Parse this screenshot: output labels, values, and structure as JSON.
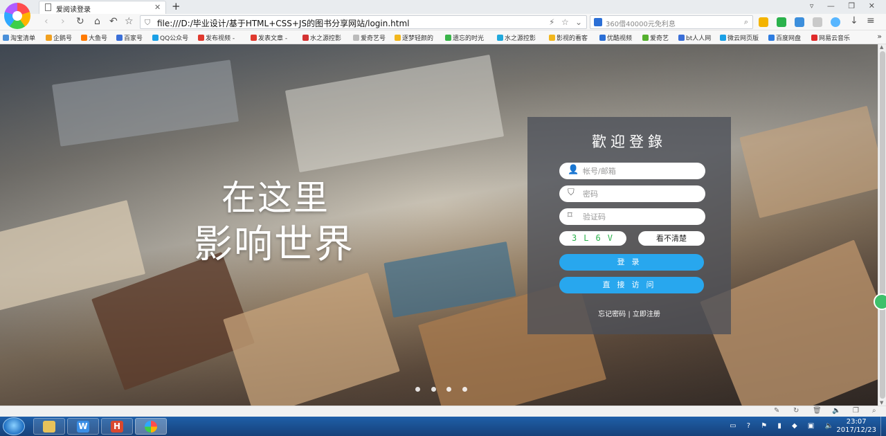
{
  "browser": {
    "tab_title": "爱阅读登录",
    "url": "file:///D:/毕业设计/基于HTML+CSS+JS的图书分享网站/login.html",
    "search_placeholder": "360借40000元免利息"
  },
  "bookmarks": [
    "淘宝清单",
    "企鹅号",
    "大鱼号",
    "百家号",
    "QQ公众号",
    "发布视频 -",
    "发表文章 -",
    "水之源控影",
    "爱奇艺号",
    "逐梦轻颜的",
    "遗忘的时光",
    "水之源控影",
    "影视的看客",
    "优酷视频",
    "爱奇艺",
    "bt人人网",
    "微云网页版",
    "百度网盘",
    "网易云音乐"
  ],
  "page": {
    "slogan_line1": "在这里",
    "slogan_line2": "影响世界",
    "welcome": "歡迎登錄",
    "username_placeholder": "帐号/邮箱",
    "password_placeholder": "密码",
    "captcha_placeholder": "验证码",
    "captcha_code": "3L6V",
    "refresh_captcha": "看不清楚",
    "login_button": "登录",
    "guest_button": "直接访问",
    "forgot_password": "忘记密码",
    "separator": "|",
    "register": "立即注册",
    "carousel_slides": 4
  },
  "taskbar": {
    "time": "23:07",
    "date": "2017/12/23"
  },
  "colors": {
    "accent_button": "#28a7ee",
    "panel_bg": "#4b5058",
    "captcha_text": "#2bb24c"
  }
}
